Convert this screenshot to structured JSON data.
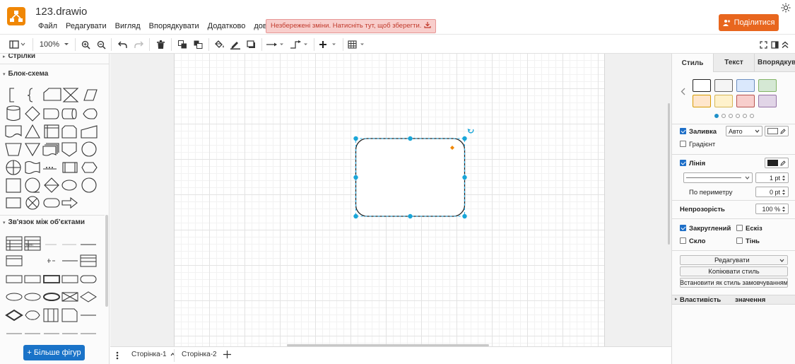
{
  "app": {
    "title": "123.drawio",
    "menu": [
      "Файл",
      "Редагувати",
      "Вигляд",
      "Впорядкувати",
      "Додатково",
      "довідка"
    ],
    "unsaved_notice": "Незбережені зміни. Натисніть тут, щоб зберегти.",
    "share_label": "Поділитися",
    "accent": "#f08705",
    "share_color": "#e8661e"
  },
  "toolbar": {
    "zoom": "100%"
  },
  "sidebar": {
    "sections": {
      "arrows": "Стрілки",
      "flowchart": "Блок-схема",
      "relations": "Зв'язок між об'єктами"
    },
    "er_item_label": "Item",
    "more_shapes": "+ Більше фігур"
  },
  "pages": {
    "tabs": [
      "Сторінка-1",
      "Сторінка-2"
    ],
    "active_index": 0
  },
  "format_panel": {
    "tabs": [
      "Стиль",
      "Текст",
      "Впорядкувати"
    ],
    "style_swatches": [
      {
        "fill": "#ffffff",
        "stroke": "#222222"
      },
      {
        "fill": "#f5f5f5",
        "stroke": "#666666"
      },
      {
        "fill": "#dae8fc",
        "stroke": "#6c8ebf"
      },
      {
        "fill": "#d5e8d4",
        "stroke": "#82b366"
      },
      {
        "fill": "#ffe6cc",
        "stroke": "#d79b00"
      },
      {
        "fill": "#fff2cc",
        "stroke": "#d6b656"
      },
      {
        "fill": "#f8cecc",
        "stroke": "#b85450"
      },
      {
        "fill": "#e1d5e7",
        "stroke": "#9673a6"
      }
    ],
    "fill": {
      "label": "Заливка",
      "checked": true,
      "mode": "Авто"
    },
    "gradient": {
      "label": "Градієнт",
      "checked": false
    },
    "line": {
      "label": "Лінія",
      "checked": true,
      "width": "1 pt"
    },
    "perimeter": {
      "label": "По периметру",
      "value": "0 pt"
    },
    "opacity": {
      "label": "Непрозорість",
      "value": "100 %"
    },
    "rounded": {
      "label": "Закруглений",
      "checked": true
    },
    "sketch": {
      "label": "Ескіз",
      "checked": false
    },
    "glass": {
      "label": "Скло",
      "checked": false
    },
    "shadow": {
      "label": "Тінь",
      "checked": false
    },
    "edit_button": "Редагувати",
    "copy_style_button": "Копіювати стиль",
    "set_default_button": "Встановити як стиль замовчуванням",
    "property_header": "Властивість",
    "value_header": "значення"
  },
  "selection_color": "#29b6f2"
}
